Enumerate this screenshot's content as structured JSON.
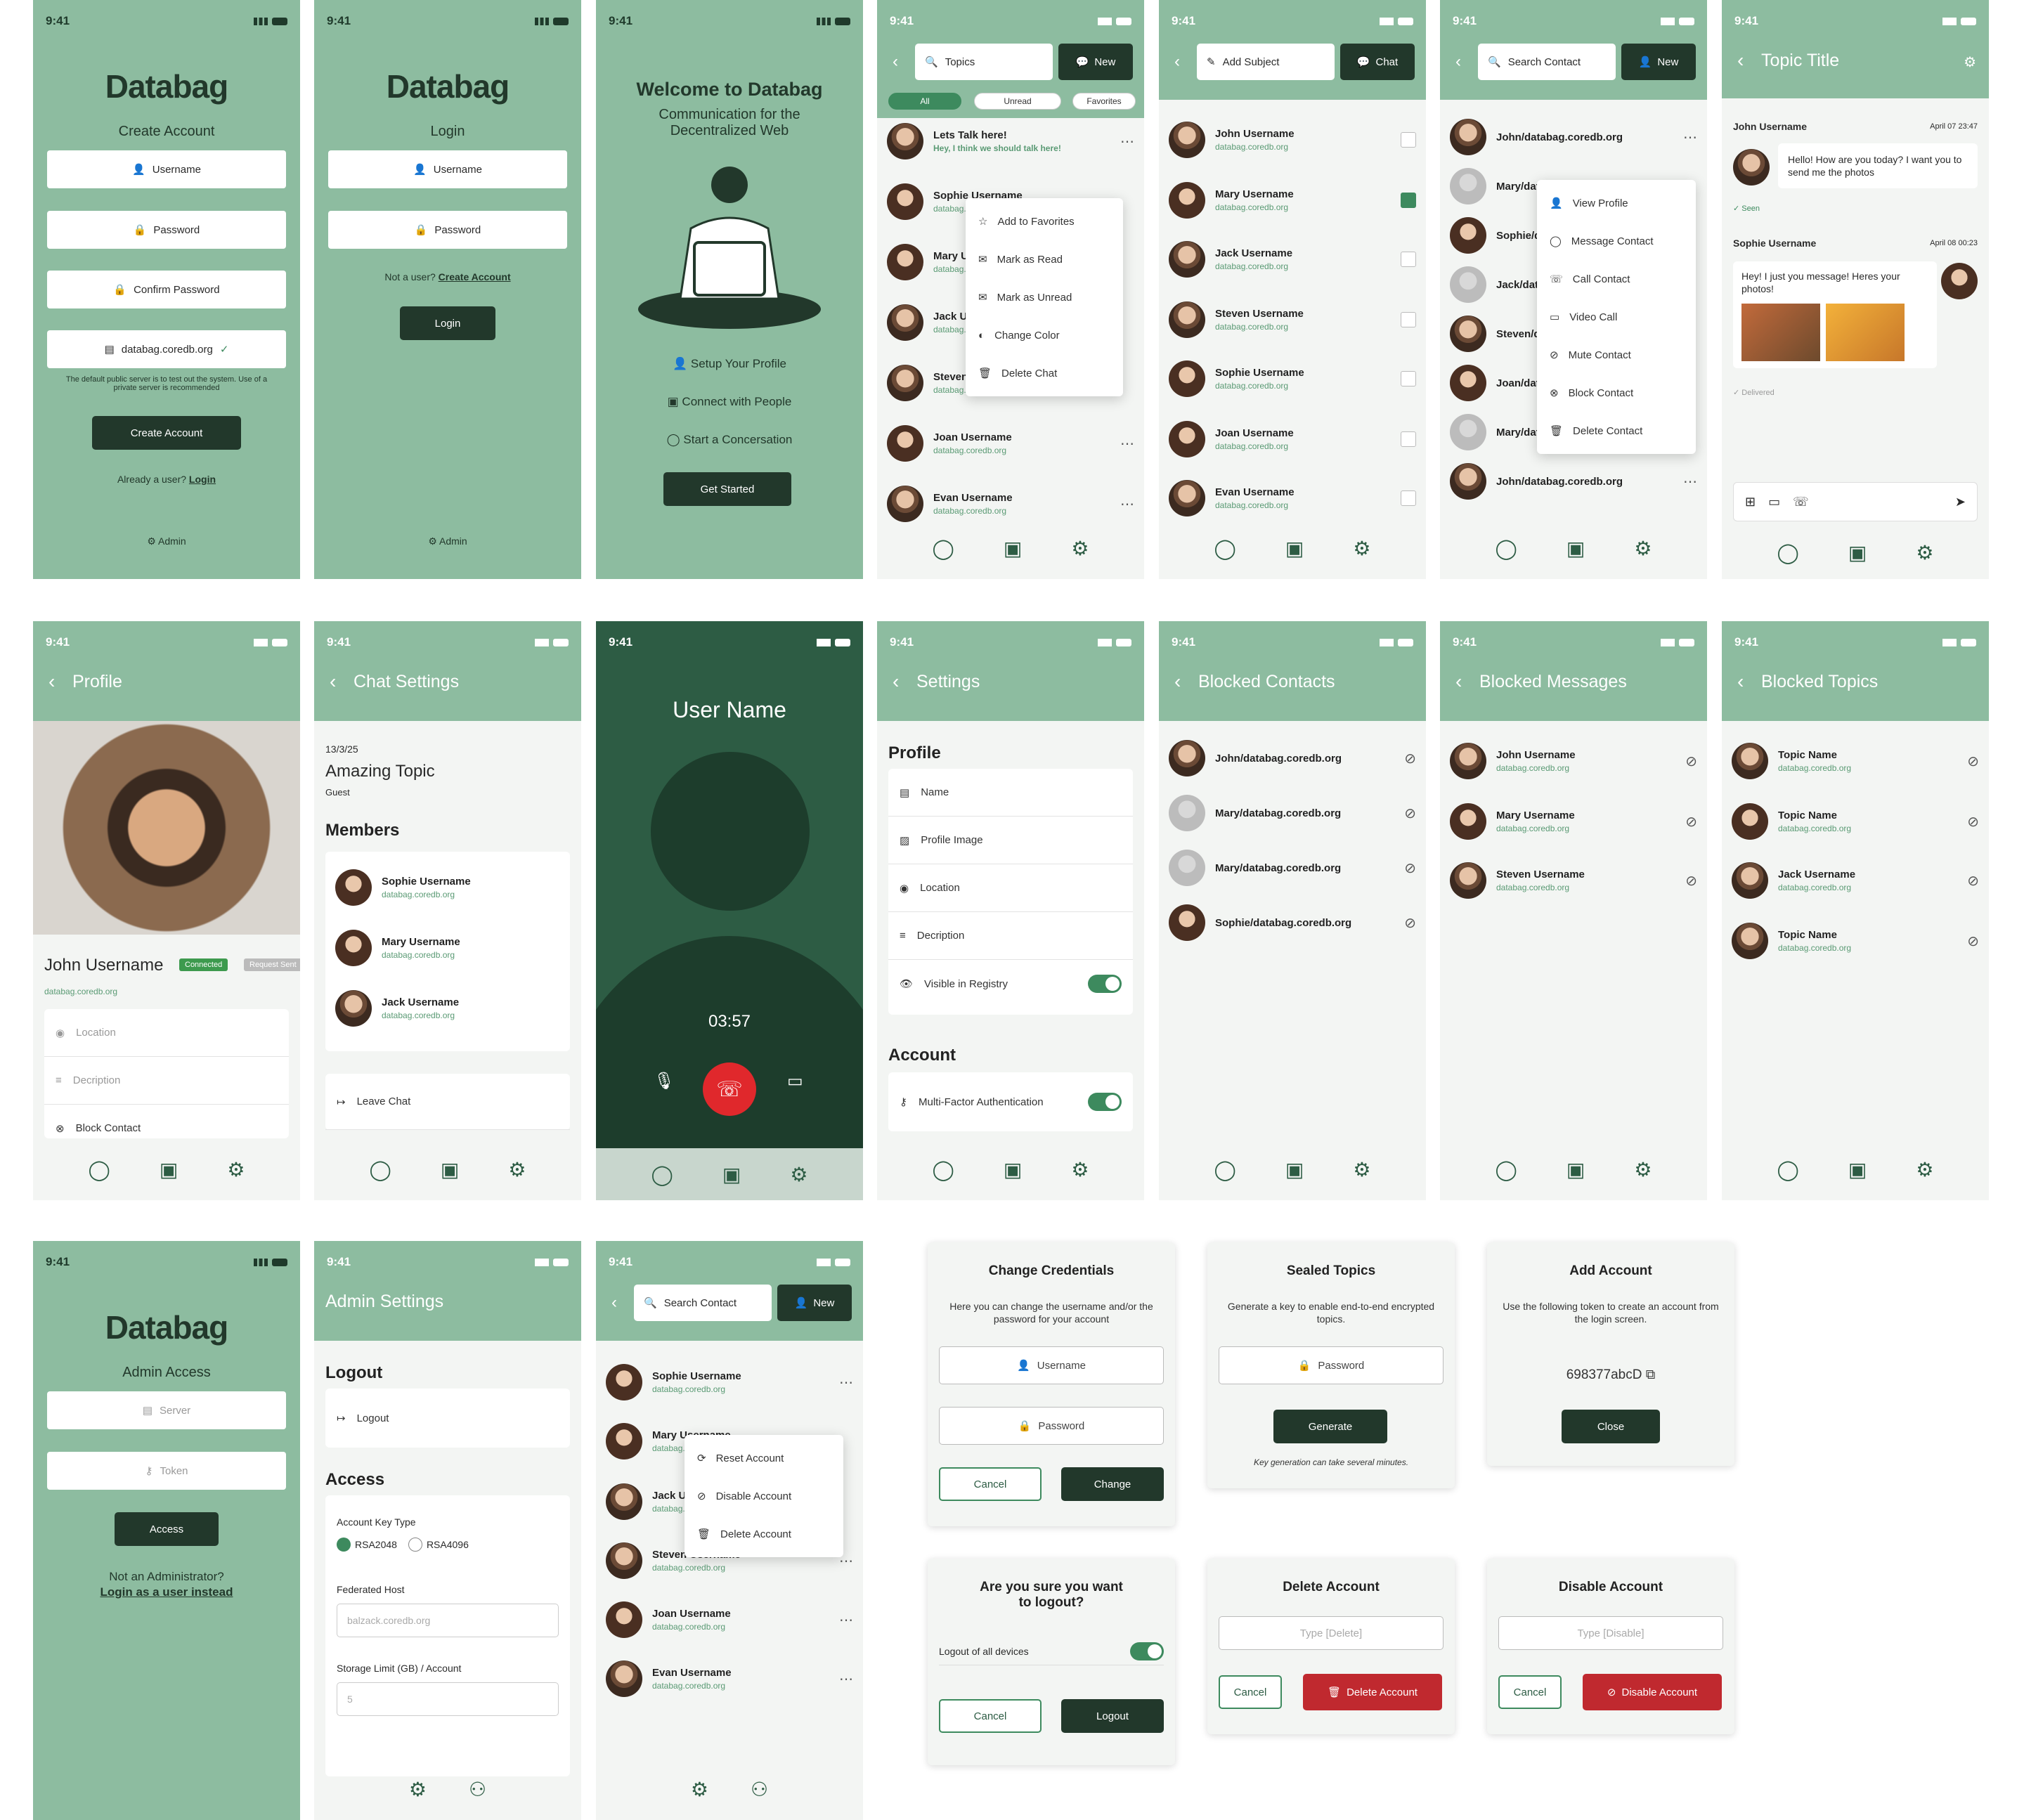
{
  "status": {
    "time": "9:41"
  },
  "databag": {
    "logo": "Databag"
  },
  "create": {
    "subtitle": "Create Account",
    "username": "Username",
    "password": "Password",
    "confirm": "Confirm Password",
    "server": "databag.coredb.org",
    "note": "The default public server is to test out the system. Use of a private server is recommended",
    "button": "Create Account",
    "already": "Already a user?",
    "login_link": "Login",
    "admin": "Admin"
  },
  "login": {
    "subtitle": "Login",
    "username": "Username",
    "password": "Password",
    "notuser": "Not a user?",
    "create_link": "Create Account",
    "button": "Login",
    "admin": "Admin"
  },
  "welcome": {
    "title": "Welcome to Databag",
    "tagline": "Communication for the Decentralized Web",
    "steps": [
      "Setup Your Profile",
      "Connect with People",
      "Start a Concersation"
    ],
    "button": "Get Started"
  },
  "topics": {
    "search": "Topics",
    "new": "New",
    "tabs": [
      "All",
      "Unread",
      "Favorites"
    ],
    "first": {
      "name": "Lets Talk here!",
      "msg": "Hey, I think we should talk here!"
    },
    "menu": [
      "Add to Favorites",
      "Mark as Read",
      "Mark as Unread",
      "Change Color",
      "Delete Chat"
    ]
  },
  "people": [
    {
      "name": "Sophie Username",
      "domain": "databag.coredb.org"
    },
    {
      "name": "Mary Username",
      "domain": "databag.coredb.org"
    },
    {
      "name": "Jack Username",
      "domain": "databag.coredb.org"
    },
    {
      "name": "Steven Username",
      "domain": "databag.coredb.org"
    },
    {
      "name": "Joan Username",
      "domain": "databag.coredb.org"
    },
    {
      "name": "Evan Username",
      "domain": "databag.coredb.org"
    },
    {
      "name": "John Username",
      "domain": "databag.coredb.org"
    }
  ],
  "addsubject": {
    "subject": "Add Subject",
    "chat": "Chat"
  },
  "contacts": {
    "search": "Search Contact",
    "new": "New",
    "rows": [
      "John/databag.coredb.org",
      "Mary/databag.coredb.org",
      "Sophie/databag.coredb.org",
      "Jack/databag.coredb.org",
      "Steven/databag.coredb.org",
      "Joan/databag.coredb.org",
      "Mary/databag.coredb.org",
      "John/databag.coredb.org"
    ],
    "menu": [
      "View Profile",
      "Message Contact",
      "Call Contact",
      "Video Call",
      "Mute Contact",
      "Block Contact",
      "Delete Contact"
    ]
  },
  "thread": {
    "title": "Topic Title",
    "m1": {
      "name": "John Username",
      "time": "April 07 23:47",
      "text": "Hello! How are you today? I want you to send me the photos",
      "status": "Seen"
    },
    "m2": {
      "name": "Sophie Username",
      "time": "April 08 00:23",
      "text": "Hey! I just you message! Heres your photos!",
      "status": "Delivered"
    }
  },
  "profile": {
    "title": "Profile",
    "name": "John Username",
    "connected": "Connected",
    "request": "Request Sent",
    "domain": "databag.coredb.org",
    "items": [
      "Location",
      "Decription",
      "Block Contact"
    ]
  },
  "chatsettings": {
    "title": "Chat Settings",
    "date": "13/3/25",
    "topic": "Amazing Topic",
    "role": "Guest",
    "members_h": "Members",
    "leave": "Leave Chat"
  },
  "call": {
    "name": "User Name",
    "timer": "03:57"
  },
  "settings": {
    "title": "Settings",
    "profile_h": "Profile",
    "items": [
      "Name",
      "Profile Image",
      "Location",
      "Decription",
      "Visible in Registry"
    ],
    "account_h": "Account",
    "mfa": "Multi-Factor Authentication"
  },
  "blocked": {
    "contacts_title": "Blocked Contacts",
    "contacts": [
      "John/databag.coredb.org",
      "Mary/databag.coredb.org",
      "Mary/databag.coredb.org",
      "Sophie/databag.coredb.org"
    ],
    "messages_title": "Blocked Messages",
    "messages": [
      "John Username",
      "Mary Username",
      "Steven Username"
    ],
    "topics_title": "Blocked Topics",
    "topics": [
      "Topic Name",
      "Topic Name",
      "Jack Username",
      "Topic Name"
    ],
    "domain": "databag.coredb.org"
  },
  "admin": {
    "subtitle": "Admin Access",
    "server": "Server",
    "token": "Token",
    "button": "Access",
    "notadmin": "Not an Administrator?",
    "userlink": "Login as a user instead"
  },
  "adminsettings": {
    "title": "Admin Settings",
    "logout_h": "Logout",
    "logout": "Logout",
    "access_h": "Access",
    "keytype": "Account Key Type",
    "rsa2048": "RSA2048",
    "rsa4096": "RSA4096",
    "fedhost": "Federated Host",
    "fedhost_ph": "balzack.coredb.org",
    "storage": "Storage Limit (GB) / Account",
    "storage_ph": "5"
  },
  "accountmenu": [
    "Reset Account",
    "Disable Account",
    "Delete Account"
  ],
  "dlg_creds": {
    "title": "Change Credentials",
    "text": "Here you can change the username and/or the password for your account",
    "username": "Username",
    "password": "Password",
    "cancel": "Cancel",
    "ok": "Change"
  },
  "dlg_sealed": {
    "title": "Sealed Topics",
    "text": "Generate a key to enable end-to-end encrypted topics.",
    "password": "Password",
    "ok": "Generate",
    "note": "Key generation can take several minutes."
  },
  "dlg_add": {
    "title": "Add Account",
    "text": "Use the following token to create an account from the login screen.",
    "token": "698377abcD",
    "ok": "Close"
  },
  "dlg_logout": {
    "title": "Are you sure you want to logout?",
    "label": "Logout of all devices",
    "cancel": "Cancel",
    "ok": "Logout"
  },
  "dlg_delete": {
    "title": "Delete Account",
    "ph": "Type [Delete]",
    "cancel": "Cancel",
    "ok": "Delete Account"
  },
  "dlg_disable": {
    "title": "Disable Account",
    "ph": "Type [Disable]",
    "cancel": "Cancel",
    "ok": "Disable Account"
  }
}
